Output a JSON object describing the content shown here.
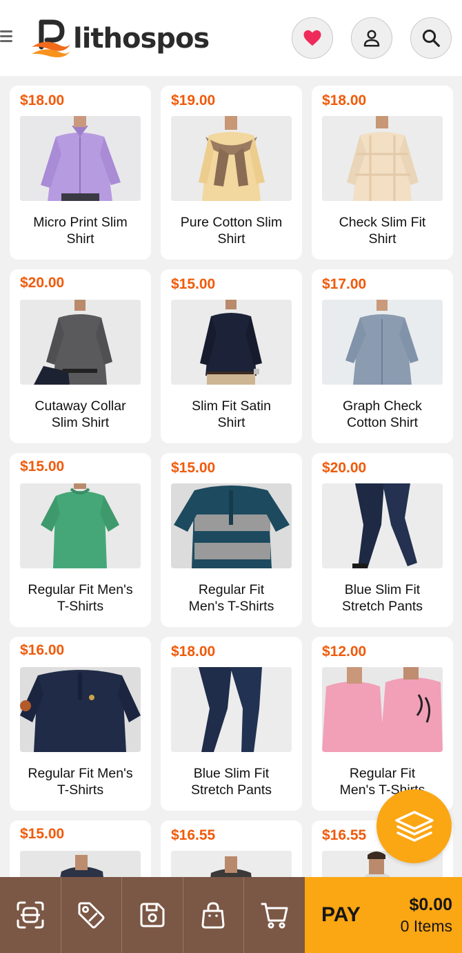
{
  "app": {
    "logo_text": "lithospos"
  },
  "header": {
    "wishlist_icon": "heart-icon",
    "account_icon": "user-icon",
    "search_icon": "search-icon"
  },
  "products": [
    {
      "price": "$18.00",
      "name_line1": "Micro Print Slim",
      "name_line2": "Shirt"
    },
    {
      "price": "$19.00",
      "name_line1": "Pure Cotton Slim",
      "name_line2": "Shirt"
    },
    {
      "price": "$18.00",
      "name_line1": "Check Slim Fit",
      "name_line2": "Shirt"
    },
    {
      "price": "$20.00",
      "name_line1": "Cutaway Collar",
      "name_line2": "Slim Shirt"
    },
    {
      "price": "$15.00",
      "name_line1": "Slim Fit Satin",
      "name_line2": "Shirt"
    },
    {
      "price": "$17.00",
      "name_line1": "Graph Check",
      "name_line2": "Cotton Shirt"
    },
    {
      "price": "$15.00",
      "name_line1": "Regular Fit Men's",
      "name_line2": "T-Shirts"
    },
    {
      "price": "$15.00",
      "name_line1": "Regular Fit",
      "name_line2": "Men's T-Shirts"
    },
    {
      "price": "$20.00",
      "name_line1": "Blue Slim Fit",
      "name_line2": "Stretch Pants"
    },
    {
      "price": "$16.00",
      "name_line1": "Regular Fit Men's",
      "name_line2": "T-Shirts"
    },
    {
      "price": "$18.00",
      "name_line1": "Blue Slim Fit",
      "name_line2": "Stretch Pants"
    },
    {
      "price": "$12.00",
      "name_line1": "Regular Fit",
      "name_line2": "Men's T-Shirts"
    },
    {
      "price": "$15.00",
      "name_line1": "",
      "name_line2": ""
    },
    {
      "price": "$16.55",
      "name_line1": "",
      "name_line2": ""
    },
    {
      "price": "$16.55",
      "name_line1": "",
      "name_line2": ""
    }
  ],
  "bottom_bar": {
    "tools": [
      "scan-icon",
      "tag-icon",
      "save-icon",
      "bag-icon",
      "cart-icon"
    ],
    "pay_label": "PAY",
    "total": "$0.00",
    "items": "0 Items"
  },
  "colors": {
    "price": "#f05a0a",
    "accent": "#fba613",
    "bottom_bar": "#7b5745",
    "heart": "#ef2b5b"
  }
}
